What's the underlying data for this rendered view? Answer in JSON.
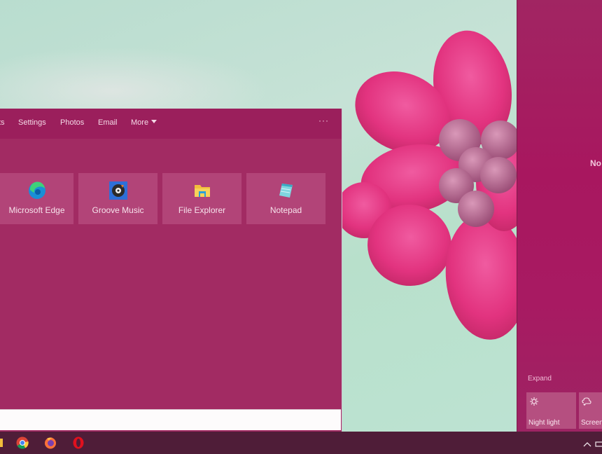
{
  "start_menu": {
    "tabs": [
      {
        "label": "ts"
      },
      {
        "label": "Settings"
      },
      {
        "label": "Photos"
      },
      {
        "label": "Email"
      },
      {
        "label": "More"
      }
    ],
    "options_label": "···",
    "top_apps": [
      {
        "label": "Microsoft Edge",
        "icon": "edge-icon"
      },
      {
        "label": "Groove Music",
        "icon": "groove-music-icon"
      },
      {
        "label": "File Explorer",
        "icon": "file-explorer-icon"
      },
      {
        "label": "Notepad",
        "icon": "notepad-icon"
      }
    ],
    "search_value": ""
  },
  "action_center": {
    "no_notifications_text": "No",
    "expand_label": "Expand",
    "quick_actions": [
      {
        "label": "Night light",
        "icon": "night-light-icon"
      },
      {
        "label": "Screen",
        "icon": "screen-snip-icon"
      }
    ]
  },
  "taskbar": {
    "pinned": [
      {
        "name": "file-explorer"
      },
      {
        "name": "chrome"
      },
      {
        "name": "firefox"
      },
      {
        "name": "opera"
      }
    ],
    "tray_chevron": "^"
  },
  "colors": {
    "accent": "#a22b63",
    "tile": "#b24478",
    "taskbar": "#4f1d38"
  }
}
